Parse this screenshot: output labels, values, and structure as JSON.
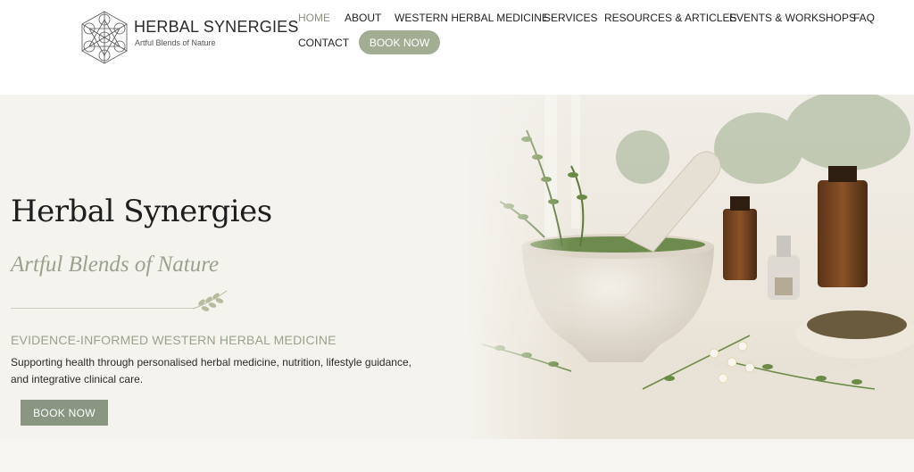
{
  "brand": {
    "name": "HERBAL SYNERGIES",
    "tagline": "Artful Blends of Nature"
  },
  "nav": {
    "items": [
      {
        "label": "HOME",
        "active": true
      },
      {
        "label": "ABOUT"
      },
      {
        "label": "WESTERN HERBAL MEDICINE"
      },
      {
        "label": "SERVICES"
      },
      {
        "label": "RESOURCES & ARTICLES"
      },
      {
        "label": "EVENTS & WORKSHOPS"
      },
      {
        "label": "FAQ"
      },
      {
        "label": "CONTACT"
      }
    ],
    "cta": "BOOK NOW"
  },
  "hero": {
    "title": "Herbal Synergies",
    "subtitle": "Artful Blends of Nature",
    "kicker": "EVIDENCE-INFORMED WESTERN HERBAL MEDICINE",
    "description": "Supporting health through personalised herbal medicine, nutrition, lifestyle guidance, and integrative clinical care.",
    "button": "BOOK NOW"
  },
  "colors": {
    "accent": "#a2ad94",
    "button": "#8a9681",
    "subtitle": "#9aa28e",
    "active_nav": "#8a8f7e"
  }
}
